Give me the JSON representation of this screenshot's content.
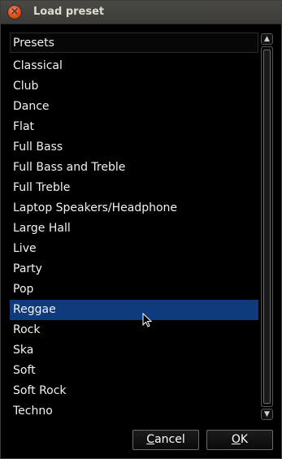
{
  "window": {
    "title": "Load preset"
  },
  "list": {
    "header": "Presets",
    "items": [
      "Classical",
      "Club",
      "Dance",
      "Flat",
      "Full Bass",
      "Full Bass and Treble",
      "Full Treble",
      "Laptop Speakers/Headphone",
      "Large Hall",
      "Live",
      "Party",
      "Pop",
      "Reggae",
      "Rock",
      "Ska",
      "Soft",
      "Soft Rock",
      "Techno"
    ],
    "selected": "Reggae"
  },
  "buttons": {
    "cancel": {
      "mnemonic": "C",
      "rest": "ancel"
    },
    "ok": {
      "mnemonic": "O",
      "rest": "K"
    }
  },
  "colors": {
    "selection": "#0f3a7c",
    "close_button": "#dd4814",
    "titlebar": "#3c3b37"
  },
  "icons": {
    "close": "close-icon",
    "scroll_up": "chevron-up-icon",
    "scroll_down": "chevron-down-icon",
    "pointer": "mouse-cursor-icon"
  }
}
